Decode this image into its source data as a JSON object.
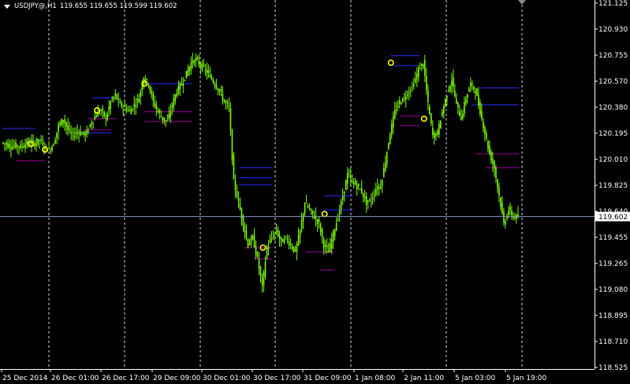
{
  "window": {
    "symbol": "USDJPY@,H1",
    "ohlc": "119.655 119.655 119.599 119.602"
  },
  "colors": {
    "background": "#000000",
    "axis": "#ffffff",
    "grid": "#ffffff",
    "candle": "#7cfc00",
    "signal_circle": "#ffff00",
    "upper_level": "#2b2bff",
    "lower_level": "#a000a0",
    "bid_line": "#8899bb",
    "bid_label_bg": "#ffffff",
    "bid_label_text": "#000000"
  },
  "price_axis": {
    "ticks": [
      "121.125",
      "120.930",
      "120.755",
      "120.570",
      "120.380",
      "120.195",
      "120.010",
      "119.825",
      "119.640",
      "119.455",
      "119.265",
      "119.080",
      "118.895",
      "118.710",
      "118.525"
    ],
    "current_price": "119.602"
  },
  "time_axis": {
    "ticks": [
      "25 Dec 2014",
      "26 Dec 01:00",
      "26 Dec 17:00",
      "29 Dec 09:00",
      "30 Dec 01:00",
      "30 Dec 17:00",
      "31 Dec 09:00",
      "1 Jan 08:00",
      "2 Jan 11:00",
      "5 Jan 03:00",
      "5 Jan 19:00"
    ]
  },
  "chart_data": {
    "type": "candlestick",
    "symbol": "USDJPY@",
    "timeframe": "H1",
    "ylim": [
      118.525,
      121.125
    ],
    "x_tick_labels": [
      "25 Dec 2014",
      "26 Dec 01:00",
      "26 Dec 17:00",
      "29 Dec 09:00",
      "30 Dec 01:00",
      "30 Dec 17:00",
      "31 Dec 09:00",
      "1 Jan 08:00",
      "2 Jan 11:00",
      "5 Jan 03:00",
      "5 Jan 19:00"
    ],
    "grid": "vertical dashed at session boundaries",
    "close_path": [
      120.13,
      120.12,
      120.1,
      120.11,
      120.1,
      120.12,
      120.13,
      120.12,
      120.15,
      120.1,
      120.08,
      120.12,
      120.25,
      120.3,
      120.22,
      120.18,
      120.21,
      120.19,
      120.2,
      120.28,
      120.33,
      120.36,
      120.3,
      120.42,
      120.47,
      120.4,
      120.38,
      120.35,
      120.4,
      120.45,
      120.6,
      120.55,
      120.42,
      120.35,
      120.3,
      120.28,
      120.4,
      120.5,
      120.55,
      120.62,
      120.7,
      120.72,
      120.68,
      120.65,
      120.6,
      120.55,
      120.5,
      120.42,
      120.38,
      119.85,
      119.7,
      119.55,
      119.4,
      119.45,
      119.3,
      119.1,
      119.38,
      119.45,
      119.5,
      119.42,
      119.45,
      119.4,
      119.35,
      119.5,
      119.7,
      119.65,
      119.6,
      119.55,
      119.4,
      119.35,
      119.48,
      119.6,
      119.75,
      119.9,
      119.85,
      119.82,
      119.78,
      119.7,
      119.72,
      119.8,
      119.82,
      120.0,
      120.2,
      120.35,
      120.42,
      120.45,
      120.5,
      120.55,
      120.65,
      120.7,
      120.4,
      120.18,
      120.2,
      120.35,
      120.48,
      120.58,
      120.4,
      120.3,
      120.45,
      120.55,
      120.5,
      120.35,
      120.2,
      120.05,
      119.95,
      119.75,
      119.55,
      119.65,
      119.6,
      119.6
    ],
    "signal_points": [
      {
        "x_index": 6,
        "price": 120.12
      },
      {
        "x_index": 9,
        "price": 120.08
      },
      {
        "x_index": 20,
        "price": 120.36
      },
      {
        "x_index": 30,
        "price": 120.55
      },
      {
        "x_index": 55,
        "price": 119.38
      },
      {
        "x_index": 68,
        "price": 119.62
      },
      {
        "x_index": 82,
        "price": 120.7
      },
      {
        "x_index": 89,
        "price": 120.3
      }
    ],
    "level_lines": [
      {
        "kind": "upper",
        "price": 120.23,
        "from": 0,
        "to": 7
      },
      {
        "kind": "upper",
        "price": 120.15,
        "from": 5,
        "to": 9
      },
      {
        "kind": "lower",
        "price": 120.0,
        "from": 3,
        "to": 9
      },
      {
        "kind": "upper",
        "price": 120.2,
        "from": 15,
        "to": 23
      },
      {
        "kind": "upper",
        "price": 120.45,
        "from": 19,
        "to": 24
      },
      {
        "kind": "lower",
        "price": 120.22,
        "from": 17,
        "to": 23
      },
      {
        "kind": "lower",
        "price": 120.3,
        "from": 18,
        "to": 24
      },
      {
        "kind": "upper",
        "price": 120.55,
        "from": 30,
        "to": 40
      },
      {
        "kind": "lower",
        "price": 120.35,
        "from": 30,
        "to": 40
      },
      {
        "kind": "lower",
        "price": 120.28,
        "from": 30,
        "to": 40
      },
      {
        "kind": "upper",
        "price": 119.95,
        "from": 50,
        "to": 57
      },
      {
        "kind": "upper",
        "price": 119.88,
        "from": 50,
        "to": 57
      },
      {
        "kind": "upper",
        "price": 119.83,
        "from": 50,
        "to": 57
      },
      {
        "kind": "lower",
        "price": 119.38,
        "from": 51,
        "to": 57
      },
      {
        "kind": "lower",
        "price": 119.3,
        "from": 53,
        "to": 57
      },
      {
        "kind": "upper",
        "price": 119.75,
        "from": 68,
        "to": 74
      },
      {
        "kind": "upper",
        "price": 119.65,
        "from": 68,
        "to": 74
      },
      {
        "kind": "lower",
        "price": 119.35,
        "from": 64,
        "to": 70
      },
      {
        "kind": "lower",
        "price": 119.22,
        "from": 67,
        "to": 70
      },
      {
        "kind": "upper",
        "price": 120.75,
        "from": 82,
        "to": 88
      },
      {
        "kind": "upper",
        "price": 120.68,
        "from": 82,
        "to": 88
      },
      {
        "kind": "lower",
        "price": 120.32,
        "from": 84,
        "to": 88
      },
      {
        "kind": "lower",
        "price": 120.25,
        "from": 84,
        "to": 88
      },
      {
        "kind": "upper",
        "price": 120.52,
        "from": 101,
        "to": 109
      },
      {
        "kind": "upper",
        "price": 120.4,
        "from": 99,
        "to": 109
      },
      {
        "kind": "lower",
        "price": 120.05,
        "from": 100,
        "to": 109
      },
      {
        "kind": "lower",
        "price": 119.95,
        "from": 102,
        "to": 109
      }
    ]
  }
}
